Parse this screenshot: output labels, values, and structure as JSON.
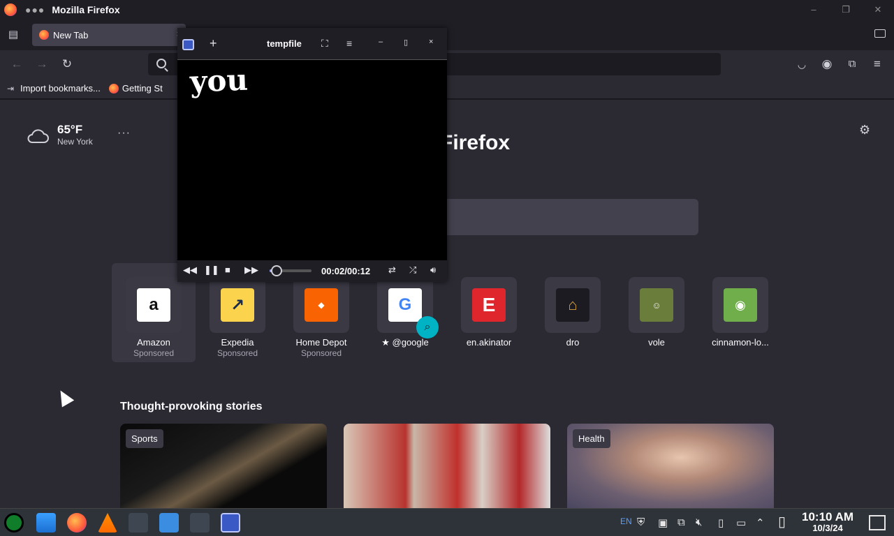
{
  "window": {
    "title": "Mozilla Firefox",
    "minimize": "–",
    "maximize": "❐",
    "close": "✕"
  },
  "tabs": [
    {
      "label": "New Tab",
      "close": "×"
    }
  ],
  "bookmarks": [
    {
      "label": "Import bookmarks..."
    },
    {
      "label": "Getting St"
    }
  ],
  "weather": {
    "temp": "65°F",
    "city": "New York"
  },
  "brand": {
    "text": "Firefox"
  },
  "top_sites": [
    {
      "name": "Amazon",
      "sub": "Sponsored"
    },
    {
      "name": "Expedia",
      "sub": "Sponsored"
    },
    {
      "name": "Home Depot",
      "sub": "Sponsored"
    },
    {
      "name": "@google",
      "sub": ""
    },
    {
      "name": "en.akinator",
      "sub": ""
    },
    {
      "name": "dro",
      "sub": ""
    },
    {
      "name": "vole",
      "sub": ""
    },
    {
      "name": "cinnamon-lo...",
      "sub": ""
    }
  ],
  "stories": {
    "title": "Thought-provoking stories",
    "cards": [
      {
        "badge": "Sports"
      },
      {
        "badge": ""
      },
      {
        "badge": "Health"
      }
    ]
  },
  "player": {
    "title": "tempfile",
    "caption": "you",
    "time": "00:02/00:12",
    "progress": 0.1667
  },
  "taskbar": {
    "lang": "EN",
    "clock_time": "10:10 AM",
    "clock_date": "10/3/24"
  },
  "colors": {
    "accent": "#00b3c4",
    "amazon": "#ffffff",
    "expedia": "#fcd34d",
    "homedepot": "#f96302",
    "akinator": "#e0262d"
  }
}
